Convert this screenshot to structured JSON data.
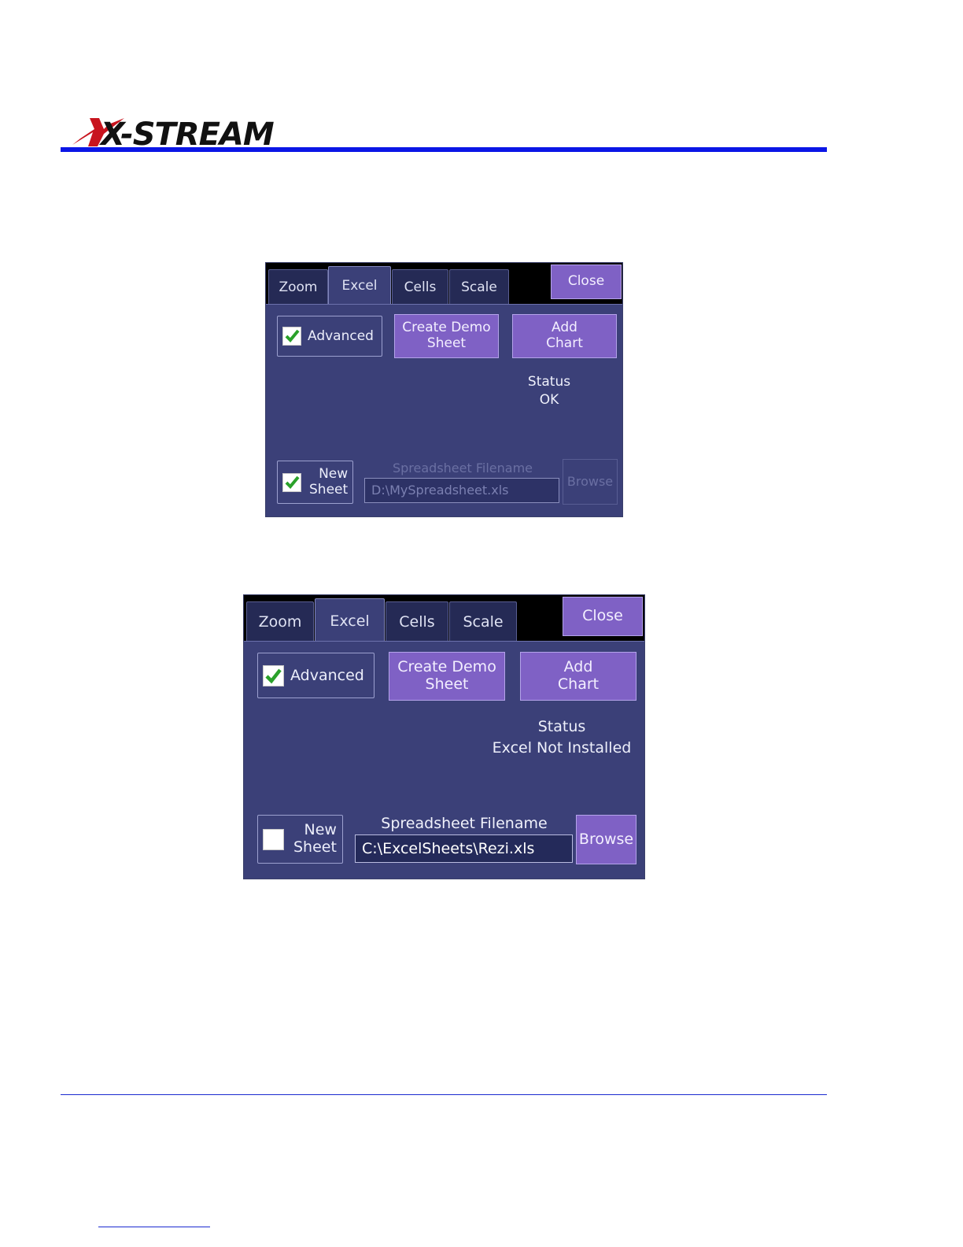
{
  "brand": {
    "logo_text": "X-STREAM",
    "rule_color": "#0b16e6"
  },
  "colors": {
    "panel_bg": "#3b4078",
    "tab_bg": "#252a55",
    "button_bg": "#7f61c5",
    "check_green": "#2aa12a"
  },
  "dialogs": [
    {
      "tabs": [
        "Zoom",
        "Excel",
        "Cells",
        "Scale"
      ],
      "active_tab": "Excel",
      "close_label": "Close",
      "advanced": {
        "label": "Advanced",
        "checked": true
      },
      "create_demo": {
        "line1": "Create Demo",
        "line2": "Sheet"
      },
      "add_chart": {
        "line1": "Add",
        "line2": "Chart"
      },
      "status": {
        "label": "Status",
        "value": "OK"
      },
      "new_sheet": {
        "line1": "New",
        "line2": "Sheet",
        "checked": true
      },
      "filename": {
        "label": "Spreadsheet Filename",
        "value": "D:\\MySpreadsheet.xls",
        "enabled": false
      },
      "browse_label": "Browse",
      "browse_enabled": false
    },
    {
      "tabs": [
        "Zoom",
        "Excel",
        "Cells",
        "Scale"
      ],
      "active_tab": "Excel",
      "close_label": "Close",
      "advanced": {
        "label": "Advanced",
        "checked": true
      },
      "create_demo": {
        "line1": "Create Demo",
        "line2": "Sheet"
      },
      "add_chart": {
        "line1": "Add",
        "line2": "Chart"
      },
      "status": {
        "label": "Status",
        "value": "Excel Not Installed"
      },
      "new_sheet": {
        "line1": "New",
        "line2": "Sheet",
        "checked": false
      },
      "filename": {
        "label": "Spreadsheet Filename",
        "value": "C:\\ExcelSheets\\Rezi.xls",
        "enabled": true
      },
      "browse_label": "Browse",
      "browse_enabled": true
    }
  ]
}
